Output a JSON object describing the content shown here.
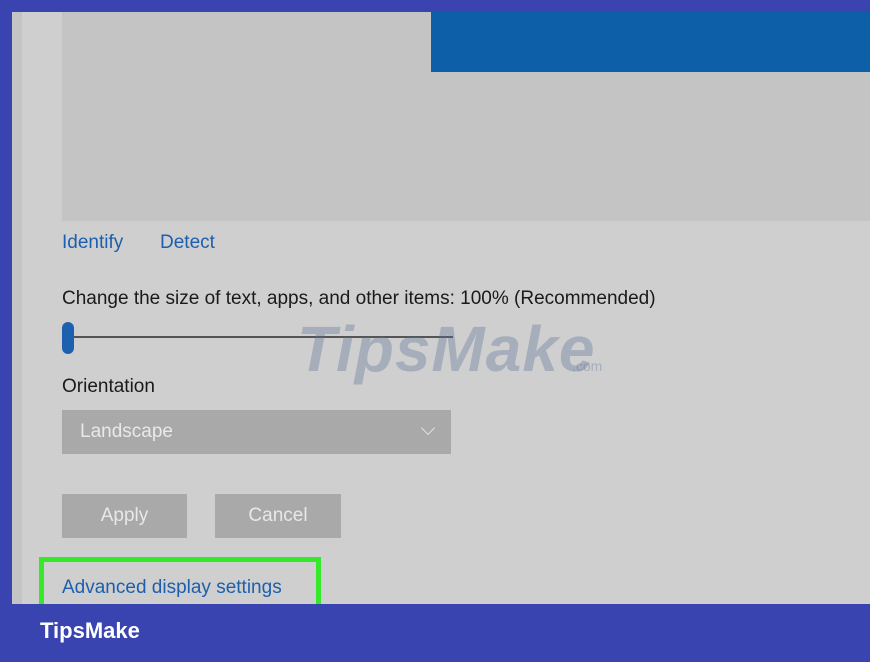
{
  "display": {
    "links": {
      "identify": "Identify",
      "detect": "Detect"
    },
    "scale_label": "Change the size of text, apps, and other items: 100% (Recommended)",
    "scale_value_percent": 100,
    "orientation_label": "Orientation",
    "orientation_value": "Landscape",
    "apply_label": "Apply",
    "cancel_label": "Cancel",
    "advanced_link": "Advanced display settings"
  },
  "watermark": {
    "main": "TipsMake",
    "suffix": ".com"
  },
  "footer": {
    "brand": "TipsMake"
  },
  "colors": {
    "accent": "#1c5fae",
    "highlight": "#35e82a",
    "frame": "#3a44b0"
  }
}
